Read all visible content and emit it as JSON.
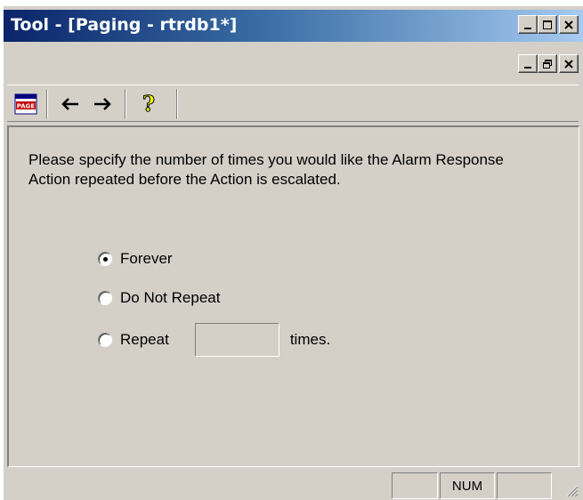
{
  "window": {
    "title": "Tool - [Paging - rtrdb1*]"
  },
  "toolbar": {
    "items": [
      {
        "icon": "page-icon",
        "label": "PAGE"
      },
      {
        "icon": "back-arrow-icon",
        "label": "←"
      },
      {
        "icon": "forward-arrow-icon",
        "label": "→"
      },
      {
        "icon": "help-icon",
        "label": "?"
      }
    ]
  },
  "main": {
    "prompt": "Please specify the number of times you would like the Alarm Response Action repeated before the Action is escalated.",
    "options": [
      {
        "label": "Forever",
        "checked": true
      },
      {
        "label": "Do Not Repeat",
        "checked": false
      },
      {
        "label": "Repeat",
        "checked": false
      }
    ],
    "repeat_count_value": "",
    "times_label": "times."
  },
  "statusbar": {
    "num_indicator": "NUM"
  },
  "colors": {
    "titlebar_start": "#0a246a",
    "titlebar_end": "#a6caf0",
    "face": "#d4d0c8"
  }
}
